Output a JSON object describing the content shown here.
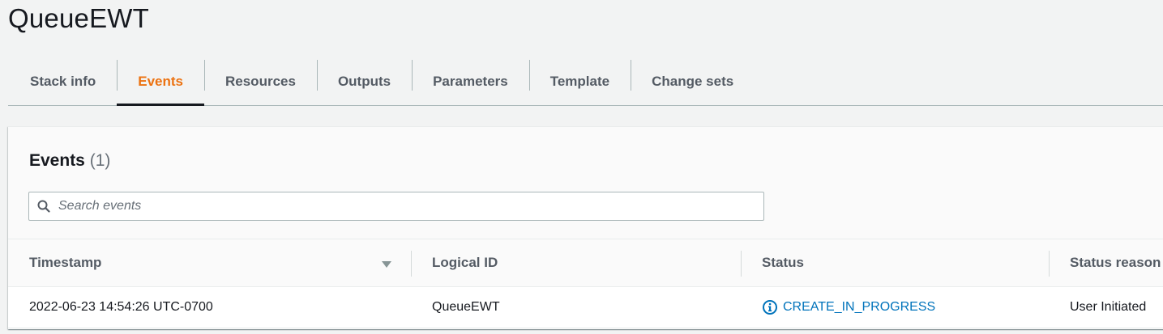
{
  "page": {
    "title": "QueueEWT"
  },
  "tabs": [
    {
      "label": "Stack info",
      "active": false
    },
    {
      "label": "Events",
      "active": true
    },
    {
      "label": "Resources",
      "active": false
    },
    {
      "label": "Outputs",
      "active": false
    },
    {
      "label": "Parameters",
      "active": false
    },
    {
      "label": "Template",
      "active": false
    },
    {
      "label": "Change sets",
      "active": false
    }
  ],
  "events": {
    "heading": "Events",
    "count": "(1)",
    "search": {
      "placeholder": "Search events",
      "value": "",
      "icon": "search-icon"
    },
    "columns": {
      "timestamp": "Timestamp",
      "logical_id": "Logical ID",
      "status": "Status",
      "status_reason": "Status reason"
    },
    "sort": {
      "column": "timestamp",
      "direction": "descending",
      "icon": "caret-down-icon"
    },
    "rows": [
      {
        "timestamp": "2022-06-23 14:54:26 UTC-0700",
        "logical_id": "QueueEWT",
        "status": "CREATE_IN_PROGRESS",
        "status_icon": "info-icon",
        "status_reason": "User Initiated"
      }
    ]
  },
  "colors": {
    "accent_active_tab": "#ec7211",
    "link": "#0073bb",
    "text": "#16191f",
    "muted": "#545b64"
  }
}
